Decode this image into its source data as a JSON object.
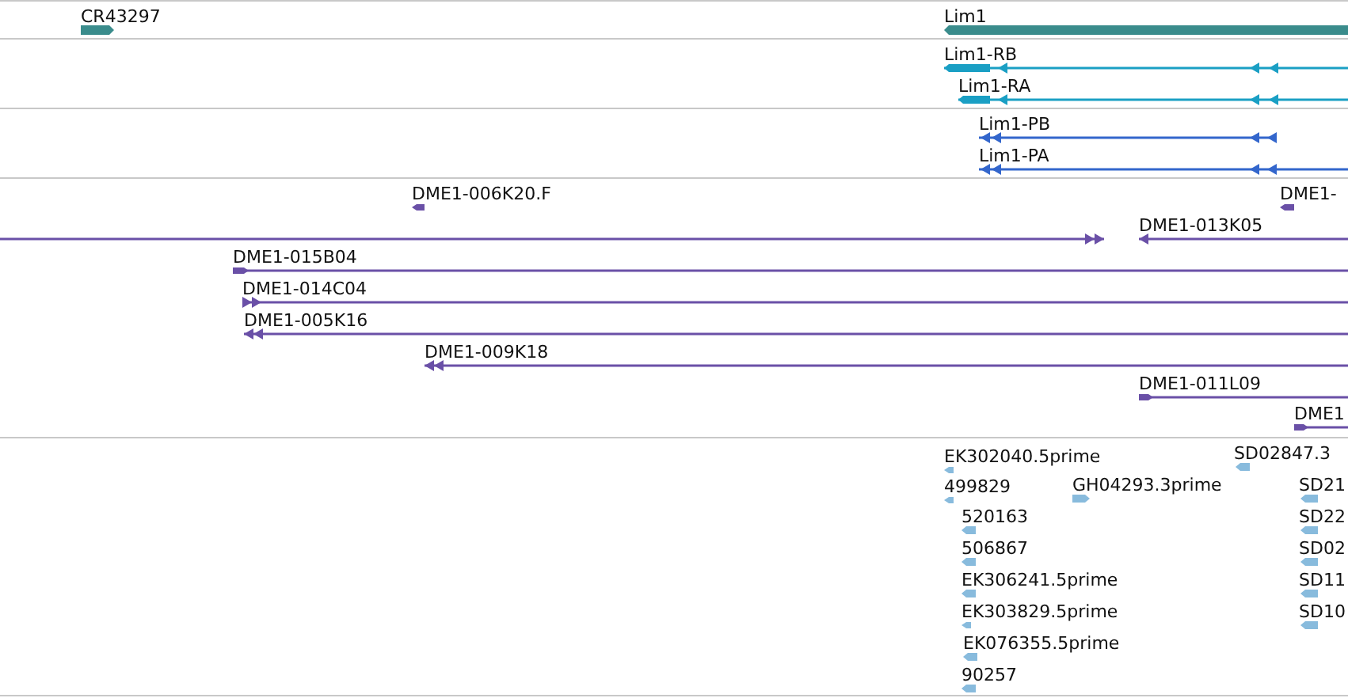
{
  "tracks": [
    {
      "kind": "gene",
      "features": [
        {
          "label": "CR43297",
          "reverse": false
        },
        {
          "label": "Lim1",
          "reverse": true
        }
      ]
    },
    {
      "kind": "transcript",
      "features": [
        {
          "label": "Lim1-RB",
          "reverse": true
        },
        {
          "label": "Lim1-RA",
          "reverse": true
        }
      ]
    },
    {
      "kind": "protein",
      "features": [
        {
          "label": "Lim1-PB",
          "reverse": true
        },
        {
          "label": "Lim1-PA",
          "reverse": true
        }
      ]
    },
    {
      "kind": "clone",
      "features": [
        {
          "label": "DME1-006K20.F",
          "reverse": true
        },
        {
          "label": "DME1-",
          "reverse": true
        },
        {
          "reverse": false
        },
        {
          "label": "DME1-013K05",
          "reverse": true
        },
        {
          "label": "DME1-015B04",
          "reverse": false
        },
        {
          "label": "DME1-014C04",
          "reverse": false
        },
        {
          "label": "DME1-005K16",
          "reverse": true
        },
        {
          "label": "DME1-009K18",
          "reverse": true
        },
        {
          "label": "DME1-011L09",
          "reverse": false
        },
        {
          "label": "DME1",
          "reverse": false
        }
      ]
    },
    {
      "kind": "est",
      "features": [
        {
          "label": "EK302040.5prime",
          "reverse": true
        },
        {
          "label": "SD02847.3",
          "reverse": true
        },
        {
          "label": "499829",
          "reverse": true
        },
        {
          "label": "GH04293.3prime",
          "reverse": false
        },
        {
          "label": "SD21",
          "reverse": true
        },
        {
          "label": "520163",
          "reverse": true
        },
        {
          "label": "SD22",
          "reverse": true
        },
        {
          "label": "506867",
          "reverse": true
        },
        {
          "label": "SD02",
          "reverse": true
        },
        {
          "label": "EK306241.5prime",
          "reverse": true
        },
        {
          "label": "SD11",
          "reverse": true
        },
        {
          "label": "EK303829.5prime",
          "reverse": true
        },
        {
          "label": "SD10",
          "reverse": true
        },
        {
          "label": "EK076355.5prime",
          "reverse": true
        },
        {
          "label": "90257",
          "reverse": true
        }
      ]
    }
  ]
}
